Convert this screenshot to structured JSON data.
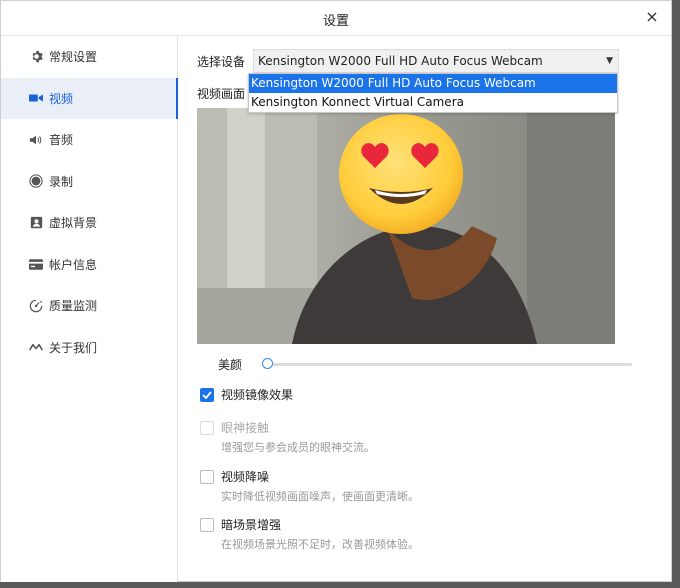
{
  "window": {
    "title": "设置",
    "close_glyph": "×"
  },
  "sidebar": {
    "items": [
      {
        "label": "常规设置",
        "icon": "gear-icon"
      },
      {
        "label": "视频",
        "icon": "video-camera-icon",
        "active": true
      },
      {
        "label": "音频",
        "icon": "speaker-icon"
      },
      {
        "label": "录制",
        "icon": "record-icon"
      },
      {
        "label": "虚拟背景",
        "icon": "portrait-icon"
      },
      {
        "label": "帐户信息",
        "icon": "card-icon"
      },
      {
        "label": "质量监测",
        "icon": "gauge-icon"
      },
      {
        "label": "关于我们",
        "icon": "logo-icon"
      }
    ]
  },
  "video": {
    "device_label": "选择设备",
    "selected_device": "Kensington W2000 Full HD Auto Focus Webcam",
    "dropdown_options": [
      "Kensington W2000 Full HD Auto Focus Webcam",
      "Kensington Konnect Virtual Camera"
    ],
    "preview_label": "视频画面",
    "beauty_label": "美颜",
    "beauty_level": 0,
    "options": [
      {
        "label": "视频镜像效果",
        "checked": true,
        "disabled": false,
        "desc": ""
      },
      {
        "label": "眼神接触",
        "checked": false,
        "disabled": true,
        "desc": "增强您与参会成员的眼神交流。"
      },
      {
        "label": "视频降噪",
        "checked": false,
        "disabled": false,
        "desc": "实时降低视频画面噪声，使画面更清晰。"
      },
      {
        "label": "暗场景增强",
        "checked": false,
        "disabled": false,
        "desc": "在视频场景光照不足时，改善视频体验。"
      }
    ]
  },
  "colors": {
    "accent": "#1a73e8",
    "active_bg": "#e9eef7"
  }
}
